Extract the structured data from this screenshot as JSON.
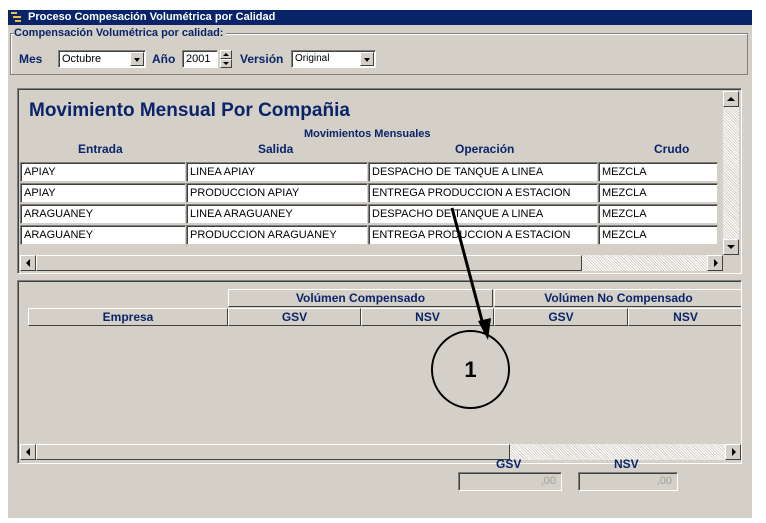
{
  "window": {
    "title": "Proceso Compesación Volumétrica por Calidad"
  },
  "filters": {
    "group_label": "Compensación Volumétrica por calidad:",
    "mes_label": "Mes",
    "mes_value": "Octubre",
    "anio_label": "Año",
    "anio_value": "2001",
    "version_label": "Versión",
    "version_value": "Original"
  },
  "movements": {
    "title": "Movimiento Mensual Por Compañia",
    "subtitle": "Movimientos Mensuales",
    "columns": [
      "Entrada",
      "Salida",
      "Operación",
      "Crudo"
    ],
    "rows": [
      [
        "APIAY",
        "LINEA APIAY",
        "DESPACHO DE TANQUE A LINEA",
        "MEZCLA"
      ],
      [
        "APIAY",
        "PRODUCCION APIAY",
        "ENTREGA PRODUCCION A ESTACION",
        "MEZCLA"
      ],
      [
        "ARAGUANEY",
        "LINEA ARAGUANEY",
        "DESPACHO DE TANQUE A LINEA",
        "MEZCLA"
      ],
      [
        "ARAGUANEY",
        "PRODUCCION ARAGUANEY",
        "ENTREGA PRODUCCION A ESTACION",
        "MEZCLA"
      ]
    ]
  },
  "volumes": {
    "group_compensado": "Volúmen Compensado",
    "group_no_compensado": "Volúmen No Compensado",
    "col_empresa": "Empresa",
    "col_gsv": "GSV",
    "col_nsv": "NSV",
    "col_gsv2": "GSV",
    "col_nsv2": "NSV"
  },
  "totals": {
    "gsv_label": "GSV",
    "nsv_label": "NSV",
    "gsv_value": ",00",
    "nsv_value": ",00"
  },
  "callout": {
    "label": "1"
  }
}
